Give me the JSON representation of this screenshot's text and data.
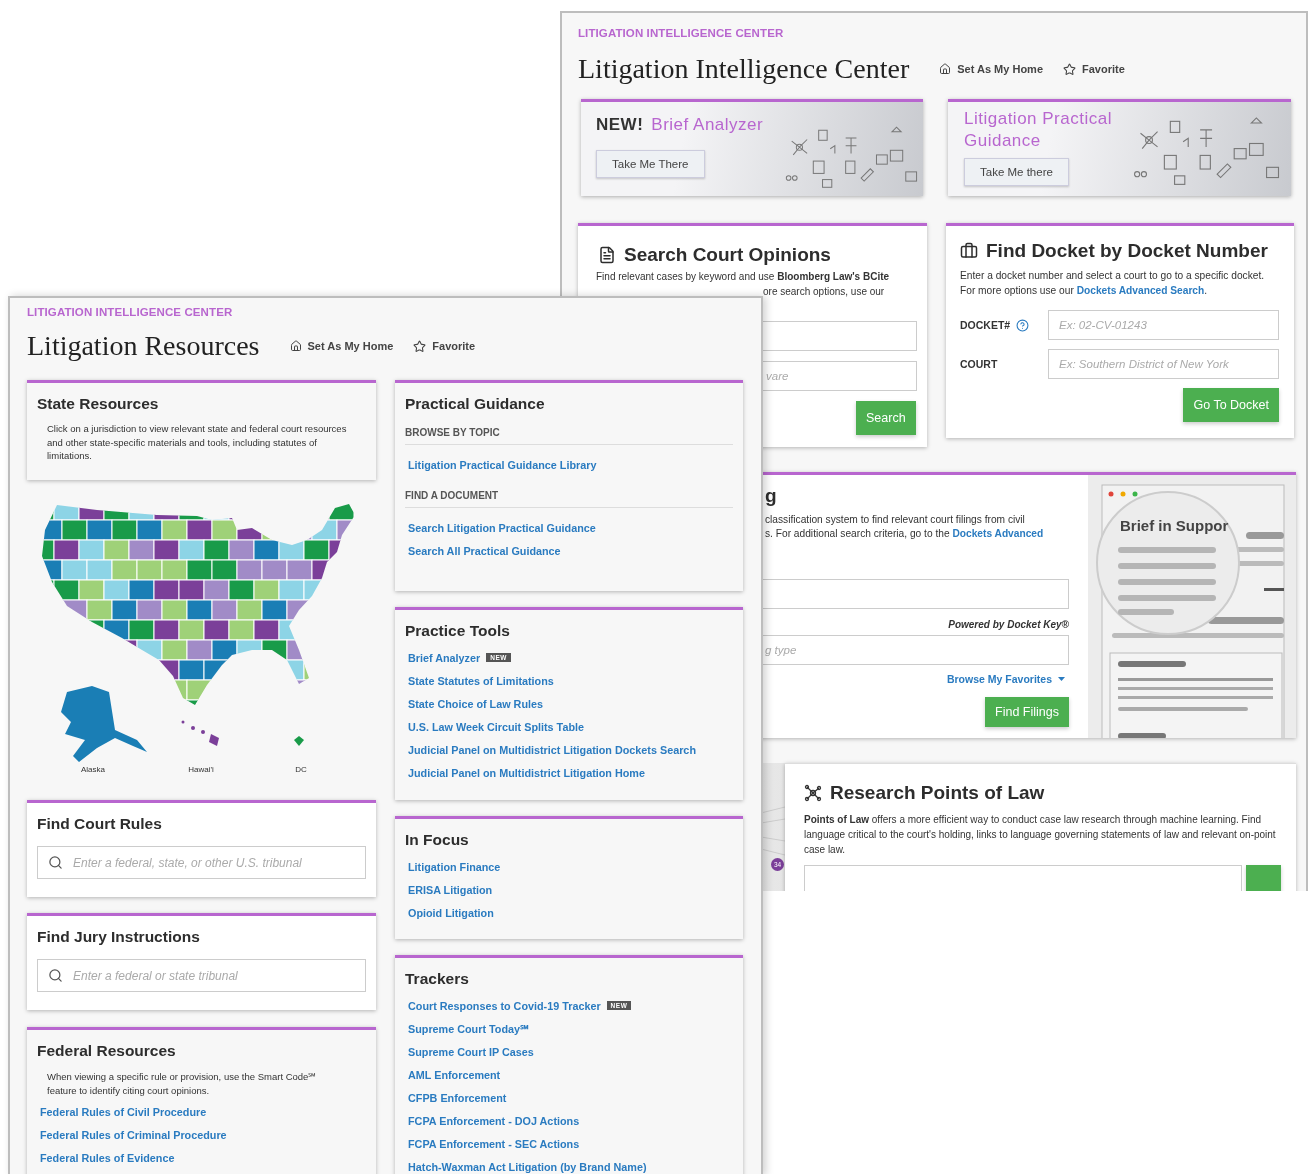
{
  "back_window": {
    "eyebrow": "LITIGATION INTELLIGENCE CENTER",
    "title": "Litigation Intelligence Center",
    "actions": [
      {
        "kind": "home",
        "label": "Set As My Home"
      },
      {
        "kind": "star",
        "label": "Favorite"
      }
    ],
    "promos": [
      {
        "badge": "NEW!",
        "title": "Brief Analyzer",
        "button": "Take Me There"
      },
      {
        "title": "Litigation Practical Guidance",
        "button": "Take Me there"
      }
    ],
    "search_opinions": {
      "title": "Search Court Opinions",
      "line_1": "Find relevant cases by keyword and use **Bloomberg Law's BCite**",
      "line_2_fragment": "ore search options, use our",
      "placeholder": "vare",
      "button": "Search"
    },
    "find_docket": {
      "title": "Find Docket by Docket Number",
      "text": "Enter a docket number and select a court to go to a specific docket. For more options use our ",
      "link": "Dockets Advanced Search",
      "text_end": ".",
      "fields": [
        {
          "label": "DOCKET#",
          "help": true,
          "placeholder": "Ex: 02-CV-01243"
        },
        {
          "label": "COURT",
          "help": false,
          "placeholder": "Ex: Southern District of New York"
        }
      ],
      "button": "Go To Docket"
    },
    "find_filings": {
      "title_fragment": "g",
      "line_1": "classification system to find relevant court filings from civil",
      "line_2": "s. For additional search criteria, go to the ",
      "link": "Dockets Advanced",
      "powered_by": "Powered by Docket Key®",
      "placeholder": "g type",
      "favorites": "Browse My Favorites",
      "button": "Find Filings",
      "illustration_text": "Brief in Suppor"
    },
    "points_of_law": {
      "badge": "34",
      "title": "Research Points of Law",
      "text": "**Points of Law** offers a more efficient way to conduct case law research through machine learning. Find language critical to the court's holding, links to language governing statements of law and relevant on-point case law."
    }
  },
  "front_window": {
    "eyebrow": "LITIGATION INTELLIGENCE CENTER",
    "title": "Litigation Resources",
    "actions": [
      {
        "kind": "home",
        "label": "Set As My Home"
      },
      {
        "kind": "star",
        "label": "Favorite"
      }
    ],
    "state_resources": {
      "title": "State Resources",
      "text": "Click on a jurisdiction to view relevant state and federal court resources and other state-specific materials and tools, including statutes of limitations."
    },
    "map": {
      "labels": [
        "Alaska",
        "Hawai'i",
        "DC"
      ]
    },
    "court_rules": {
      "title": "Find Court Rules",
      "placeholder": "Enter a federal, state, or other U.S. tribunal"
    },
    "jury_instructions": {
      "title": "Find Jury Instructions",
      "placeholder": "Enter a federal or state tribunal"
    },
    "federal_resources": {
      "title": "Federal Resources",
      "text": "When viewing a specific rule or provision, use the Smart Code℠ feature to identify citing court opinions.",
      "links": [
        "Federal Rules of Civil Procedure",
        "Federal Rules of Criminal Procedure",
        "Federal Rules of Evidence"
      ]
    },
    "practical_guidance": {
      "title": "Practical Guidance",
      "groups": [
        {
          "heading": "BROWSE BY TOPIC",
          "links": [
            "Litigation Practical Guidance Library"
          ]
        },
        {
          "heading": "FIND A DOCUMENT",
          "links": [
            "Search Litigation Practical Guidance",
            "Search All Practical Guidance"
          ]
        }
      ]
    },
    "link_cards": [
      {
        "title": "Practice Tools",
        "links": [
          {
            "label": "Brief Analyzer",
            "badge": "NEW"
          },
          {
            "label": "State Statutes of Limitations"
          },
          {
            "label": "State Choice of Law Rules"
          },
          {
            "label": "U.S. Law Week Circuit Splits Table"
          },
          {
            "label": "Judicial Panel on Multidistrict Litigation Dockets Search"
          },
          {
            "label": "Judicial Panel on Multidistrict Litigation Home"
          }
        ]
      },
      {
        "title": "In Focus",
        "links": [
          {
            "label": "Litigation Finance"
          },
          {
            "label": "ERISA Litigation"
          },
          {
            "label": "Opioid Litigation"
          }
        ]
      },
      {
        "title": "Trackers",
        "links": [
          {
            "label": "Court Responses to Covid-19 Tracker",
            "badge": "NEW"
          },
          {
            "label": "Supreme Court Today℠"
          },
          {
            "label": "Supreme Court IP Cases"
          },
          {
            "label": "AML Enforcement"
          },
          {
            "label": "CFPB Enforcement"
          },
          {
            "label": "FCPA Enforcement - DOJ Actions"
          },
          {
            "label": "FCPA Enforcement - SEC Actions"
          },
          {
            "label": "Hatch-Waxman Act Litigation (by Brand Name)"
          }
        ]
      }
    ]
  }
}
